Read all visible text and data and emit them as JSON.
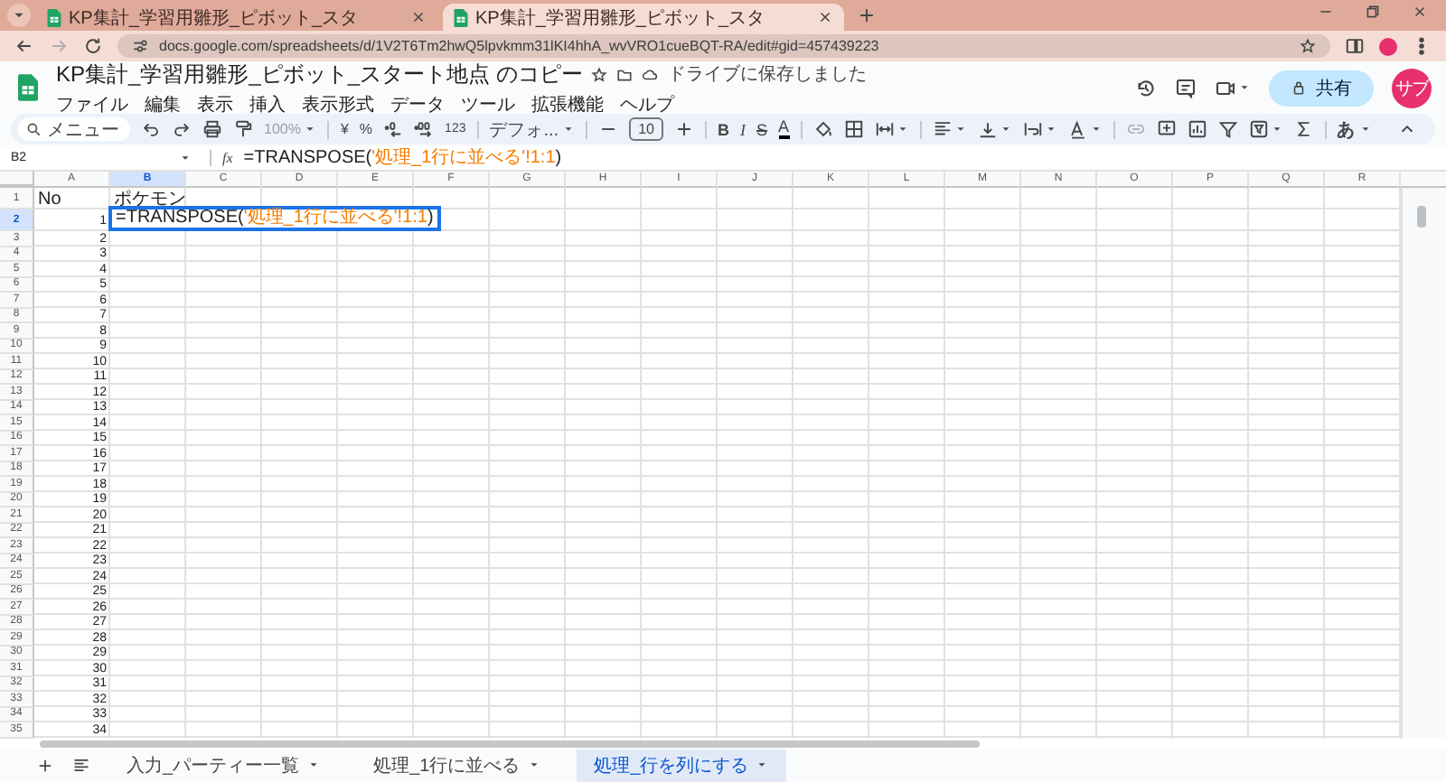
{
  "browser": {
    "tabs": [
      {
        "title": "KP集計_学習用雛形_ピボット_スタ",
        "selected": false
      },
      {
        "title": "KP集計_学習用雛形_ピボット_スタ",
        "selected": true
      }
    ],
    "url": "docs.google.com/spreadsheets/d/1V2T6Tm2hwQ5lpvkmm31lKI4hhA_wvVRO1cueBQT-RA/edit#gid=457439223"
  },
  "app": {
    "title": "KP集計_学習用雛形_ピボット_スタート地点 のコピー",
    "save_status": "ドライブに保存しました",
    "menu": [
      "ファイル",
      "編集",
      "表示",
      "挿入",
      "表示形式",
      "データ",
      "ツール",
      "拡張機能",
      "ヘルプ"
    ],
    "share": "共有",
    "avatar": "サブ"
  },
  "toolbar": {
    "search": "メニュー",
    "zoom": "100%",
    "currency": "¥",
    "percent": "%",
    "number_format": "123",
    "font": "デフォ...",
    "font_size": "10",
    "bold": "B",
    "italic": "I",
    "strikethrough": "S",
    "text_color": "A",
    "input_tools": "あ"
  },
  "formula_bar": {
    "cell": "B2",
    "function_label": "fx",
    "formula": [
      {
        "text": "=TRANSPOSE(",
        "kind": "plain"
      },
      {
        "text": "'処理_1行に並べる'!1:1",
        "kind": "range"
      },
      {
        "text": ")",
        "kind": "plain"
      }
    ]
  },
  "sheet": {
    "columns": [
      {
        "label": "A",
        "selected": false
      },
      {
        "label": "B",
        "selected": true
      },
      {
        "label": "C",
        "selected": false
      },
      {
        "label": "D",
        "selected": false
      },
      {
        "label": "E",
        "selected": false
      },
      {
        "label": "F",
        "selected": false
      },
      {
        "label": "G",
        "selected": false
      },
      {
        "label": "H",
        "selected": false
      },
      {
        "label": "I",
        "selected": false
      },
      {
        "label": "J",
        "selected": false
      },
      {
        "label": "K",
        "selected": false
      },
      {
        "label": "L",
        "selected": false
      },
      {
        "label": "M",
        "selected": false
      },
      {
        "label": "N",
        "selected": false
      },
      {
        "label": "O",
        "selected": false
      },
      {
        "label": "P",
        "selected": false
      },
      {
        "label": "Q",
        "selected": false
      },
      {
        "label": "R",
        "selected": false
      }
    ],
    "rows": [
      {
        "label": "1",
        "selected": false,
        "cells": [
          {
            "text": "No",
            "kind": "text"
          },
          {
            "text": "ポケモン",
            "kind": "text"
          }
        ]
      },
      {
        "label": "2",
        "selected": true,
        "cells": [
          {
            "text": "1",
            "kind": "number"
          }
        ]
      },
      {
        "label": "3",
        "selected": false,
        "cells": [
          {
            "text": "2",
            "kind": "number"
          }
        ]
      },
      {
        "label": "4",
        "selected": false,
        "cells": [
          {
            "text": "3",
            "kind": "number"
          }
        ]
      },
      {
        "label": "5",
        "selected": false,
        "cells": [
          {
            "text": "4",
            "kind": "number"
          }
        ]
      },
      {
        "label": "6",
        "selected": false,
        "cells": [
          {
            "text": "5",
            "kind": "number"
          }
        ]
      },
      {
        "label": "7",
        "selected": false,
        "cells": [
          {
            "text": "6",
            "kind": "number"
          }
        ]
      },
      {
        "label": "8",
        "selected": false,
        "cells": [
          {
            "text": "7",
            "kind": "number"
          }
        ]
      },
      {
        "label": "9",
        "selected": false,
        "cells": [
          {
            "text": "8",
            "kind": "number"
          }
        ]
      },
      {
        "label": "10",
        "selected": false,
        "cells": [
          {
            "text": "9",
            "kind": "number"
          }
        ]
      },
      {
        "label": "11",
        "selected": false,
        "cells": [
          {
            "text": "10",
            "kind": "number"
          }
        ]
      },
      {
        "label": "12",
        "selected": false,
        "cells": [
          {
            "text": "11",
            "kind": "number"
          }
        ]
      },
      {
        "label": "13",
        "selected": false,
        "cells": [
          {
            "text": "12",
            "kind": "number"
          }
        ]
      },
      {
        "label": "14",
        "selected": false,
        "cells": [
          {
            "text": "13",
            "kind": "number"
          }
        ]
      },
      {
        "label": "15",
        "selected": false,
        "cells": [
          {
            "text": "14",
            "kind": "number"
          }
        ]
      },
      {
        "label": "16",
        "selected": false,
        "cells": [
          {
            "text": "15",
            "kind": "number"
          }
        ]
      },
      {
        "label": "17",
        "selected": false,
        "cells": [
          {
            "text": "16",
            "kind": "number"
          }
        ]
      },
      {
        "label": "18",
        "selected": false,
        "cells": [
          {
            "text": "17",
            "kind": "number"
          }
        ]
      },
      {
        "label": "19",
        "selected": false,
        "cells": [
          {
            "text": "18",
            "kind": "number"
          }
        ]
      },
      {
        "label": "20",
        "selected": false,
        "cells": [
          {
            "text": "19",
            "kind": "number"
          }
        ]
      },
      {
        "label": "21",
        "selected": false,
        "cells": [
          {
            "text": "20",
            "kind": "number"
          }
        ]
      },
      {
        "label": "22",
        "selected": false,
        "cells": [
          {
            "text": "21",
            "kind": "number"
          }
        ]
      },
      {
        "label": "23",
        "selected": false,
        "cells": [
          {
            "text": "22",
            "kind": "number"
          }
        ]
      },
      {
        "label": "24",
        "selected": false,
        "cells": [
          {
            "text": "23",
            "kind": "number"
          }
        ]
      },
      {
        "label": "25",
        "selected": false,
        "cells": [
          {
            "text": "24",
            "kind": "number"
          }
        ]
      },
      {
        "label": "26",
        "selected": false,
        "cells": [
          {
            "text": "25",
            "kind": "number"
          }
        ]
      },
      {
        "label": "27",
        "selected": false,
        "cells": [
          {
            "text": "26",
            "kind": "number"
          }
        ]
      },
      {
        "label": "28",
        "selected": false,
        "cells": [
          {
            "text": "27",
            "kind": "number"
          }
        ]
      },
      {
        "label": "29",
        "selected": false,
        "cells": [
          {
            "text": "28",
            "kind": "number"
          }
        ]
      },
      {
        "label": "30",
        "selected": false,
        "cells": [
          {
            "text": "29",
            "kind": "number"
          }
        ]
      },
      {
        "label": "31",
        "selected": false,
        "cells": [
          {
            "text": "30",
            "kind": "number"
          }
        ]
      },
      {
        "label": "32",
        "selected": false,
        "cells": [
          {
            "text": "31",
            "kind": "number"
          }
        ]
      },
      {
        "label": "33",
        "selected": false,
        "cells": [
          {
            "text": "32",
            "kind": "number"
          }
        ]
      },
      {
        "label": "34",
        "selected": false,
        "cells": [
          {
            "text": "33",
            "kind": "number"
          }
        ]
      },
      {
        "label": "35",
        "selected": false,
        "cells": [
          {
            "text": "34",
            "kind": "number"
          }
        ]
      }
    ],
    "editor": [
      {
        "text": "=TRANSPOSE(",
        "kind": "plain"
      },
      {
        "text": "'処理_1行に並べる'!1:1",
        "kind": "range"
      },
      {
        "text": ")",
        "kind": "plain"
      }
    ]
  },
  "sheet_tabs": [
    {
      "label": "入力_パーティー一覧",
      "selected": false
    },
    {
      "label": "処理_1行に並べる",
      "selected": false
    },
    {
      "label": "処理_行を列にする",
      "selected": true
    }
  ]
}
